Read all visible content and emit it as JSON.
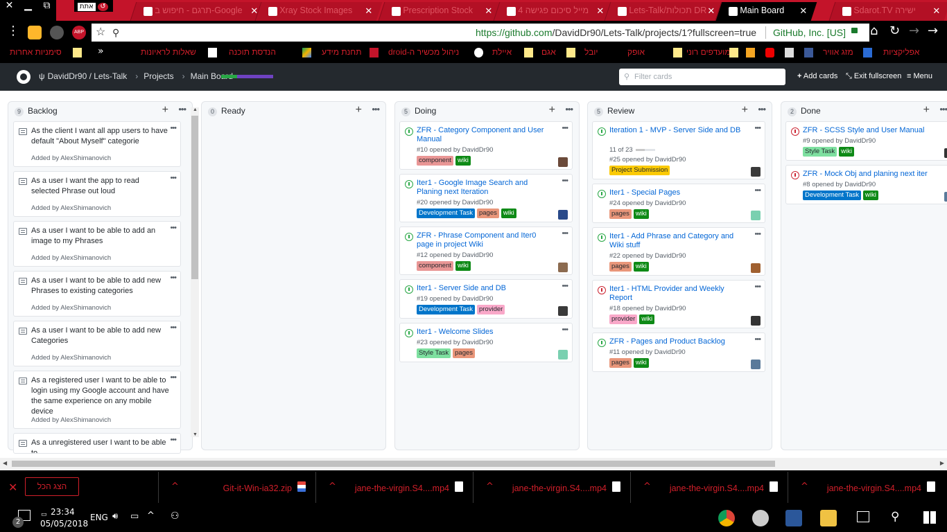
{
  "browser": {
    "window_buttons": [
      "✕",
      "",
      "⧉"
    ],
    "profile_label": "אתת",
    "tabs": [
      {
        "label": "תרגם - חיפוש ב-Google"
      },
      {
        "label": "Xray Stock Images"
      },
      {
        "label": "Prescription Stock"
      },
      {
        "label": "מייל סיכום פגישה 4"
      },
      {
        "label": "Lets-Talk/תכולות DR"
      },
      {
        "label": "Main Board",
        "active": true
      },
      {
        "label": ""
      },
      {
        "label": "Sdarot.TV ישירה"
      }
    ],
    "url_host": "https://github.com",
    "url_path": "/DavidDr90/Lets-Talk/projects/1?fullscreen=true",
    "org": "GitHub, Inc. [US]",
    "bookmarks": [
      "אפליקציות",
      "מזג אוויר",
      "מועדפים רוני",
      "אופק",
      "יובל",
      "אגם",
      "איילת",
      "ניהול מכשיר ה-droid",
      "תחנת מידע",
      "הנדסת תוכנה",
      "שאלות לראיונות",
      "סימניות אחרות"
    ]
  },
  "header": {
    "repo": "DavidDr90 / Lets-Talk",
    "projects": "Projects",
    "board": "Main Board",
    "progress": {
      "done": 0.3,
      "in_progress": 0.7,
      "colors": [
        "#28a745",
        "#6f42c1"
      ]
    },
    "filter_placeholder": "Filter cards",
    "add_cards": "Add cards",
    "exit_fullscreen": "Exit fullscreen",
    "menu": "Menu"
  },
  "columns": [
    {
      "title": "Backlog",
      "count": "9",
      "cards": [
        {
          "text": "As the client I want all app users to have default \"About Myself\" categorie",
          "added": "Added by AlexShimanovich"
        },
        {
          "text": "As a user I want the app to read selected Phrase out loud",
          "added": "Added by AlexShimanovich"
        },
        {
          "text": "As a user I want to be able to add an image to my Phrases",
          "added": "Added by AlexShimanovich"
        },
        {
          "text": "As a user I want to be able to add new Phrases to existing categories",
          "added": "Added by AlexShimanovich"
        },
        {
          "text": "As a user I want to be able to add new Categories",
          "added": "Added by AlexShimanovich"
        },
        {
          "text": "As a registered user I want to be able to login using my Google account and have the same experience on any mobile device",
          "added": "Added by AlexShimanovich"
        },
        {
          "text": "As a unregistered user I want to be able to",
          "added": ""
        }
      ]
    },
    {
      "title": "Ready",
      "count": "0",
      "cards": []
    },
    {
      "title": "Doing",
      "count": "5",
      "cards": [
        {
          "title": "ZFR - Category Component and User Manual",
          "meta": "#10 opened by DavidDr90",
          "labels": [
            "component",
            "wiki"
          ]
        },
        {
          "title": "Iter1 - Google Image Search and Planing next Iteration",
          "meta": "#20 opened by DavidDr90",
          "labels": [
            "Development Task",
            "pages",
            "wiki"
          ]
        },
        {
          "title": "ZFR - Phrase Component and Iter0 page in project Wiki",
          "meta": "#12 opened by DavidDr90",
          "labels": [
            "component",
            "wiki"
          ]
        },
        {
          "title": "Iter1 - Server Side and DB",
          "meta": "#19 opened by DavidDr90",
          "labels": [
            "Development Task",
            "provider"
          ]
        },
        {
          "title": "Iter1 - Welcome Slides",
          "meta": "#23 opened by DavidDr90",
          "labels": [
            "Style Task",
            "pages"
          ]
        }
      ]
    },
    {
      "title": "Review",
      "count": "5",
      "cards": [
        {
          "title": "Iteration 1 - MVP - Server Side and DB",
          "milestone": "11 of 23",
          "milestone_fraction": 0.48,
          "meta": "#25 opened by DavidDr90",
          "labels": [
            "Project Submission"
          ]
        },
        {
          "title": "Iter1 - Special Pages",
          "meta": "#24 opened by DavidDr90",
          "labels": [
            "pages",
            "wiki"
          ]
        },
        {
          "title": "Iter1 - Add Phrase and Category and Wiki stuff",
          "meta": "#22 opened by DavidDr90",
          "labels": [
            "pages",
            "wiki"
          ]
        },
        {
          "title": "Iter1 - HTML Provider and Weekly Report",
          "meta": "#18 opened by DavidDr90",
          "labels": [
            "provider",
            "wiki"
          ],
          "closed": true
        },
        {
          "title": "ZFR - Pages and Product Backlog",
          "meta": "#11 opened by DavidDr90",
          "labels": [
            "pages",
            "wiki"
          ]
        }
      ]
    },
    {
      "title": "Done",
      "count": "2",
      "cards": [
        {
          "title": "ZFR - SCSS Style and User Manual",
          "meta": "#9 opened by DavidDr90",
          "labels": [
            "Style Task",
            "wiki"
          ],
          "closed": true
        },
        {
          "title": "ZFR - Mock Obj and planing next iter",
          "meta": "#8 opened by DavidDr90",
          "labels": [
            "Development Task",
            "wiki"
          ],
          "closed": true
        }
      ]
    }
  ],
  "label_colors": {
    "component": {
      "bg": "#e99695",
      "fg": "#24292e"
    },
    "wiki": {
      "bg": "#0e8a16",
      "fg": "#ffffff"
    },
    "Development Task": {
      "bg": "#0075ca",
      "fg": "#ffffff"
    },
    "pages": {
      "bg": "#e9967a",
      "fg": "#24292e"
    },
    "provider": {
      "bg": "#f9a8c9",
      "fg": "#24292e"
    },
    "Style Task": {
      "bg": "#7ee0a0",
      "fg": "#24292e"
    },
    "Project Submission": {
      "bg": "#fbca04",
      "fg": "#24292e"
    }
  },
  "downloads": {
    "show_all": "הצג הכל",
    "items": [
      {
        "name": "Git-it-Win-ia32.zip",
        "icon": "zip"
      },
      {
        "name": "jane-the-virgin.S4....mp4",
        "icon": "file"
      },
      {
        "name": "jane-the-virgin.S4....mp4",
        "icon": "file"
      },
      {
        "name": "jane-the-virgin.S4....mp4",
        "icon": "file"
      },
      {
        "name": "jane-the-virgin.S4....mp4",
        "icon": "file"
      }
    ]
  },
  "taskbar": {
    "notifications": "2",
    "language": "ENG",
    "time": "23:34",
    "date": "05/05/2018"
  }
}
